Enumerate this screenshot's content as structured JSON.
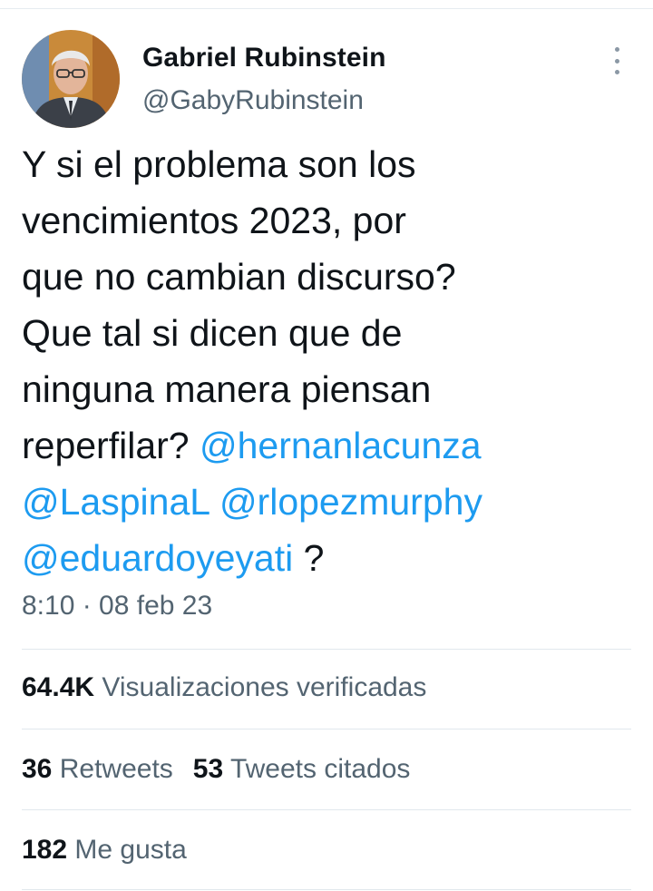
{
  "author": {
    "display_name": "Gabriel Rubinstein",
    "handle": "@GabyRubinstein"
  },
  "tweet": {
    "lines": [
      "Y si el problema son los",
      "vencimientos 2023, por",
      "que no cambian discurso?",
      "Que tal si dicen que de",
      "ninguna manera piensan"
    ],
    "line6_text": "reperfilar? ",
    "mentions": [
      "@hernanlacunza",
      "@LaspinaL",
      "@rlopezmurphy",
      "@eduardoyeyati"
    ],
    "end_text": " ?",
    "timestamp": "8:10 · 08 feb 23"
  },
  "stats": {
    "views_count": "64.4K",
    "views_label": "Visualizaciones verificadas",
    "retweets_count": "36",
    "retweets_label": "Retweets",
    "quotes_count": "53",
    "quotes_label": "Tweets citados",
    "likes_count": "182",
    "likes_label": "Me gusta"
  },
  "colors": {
    "mention": "#1d9bf0",
    "secondary_text": "#536471",
    "primary_text": "#0f1419"
  },
  "icons": {
    "more": "more-vertical-icon"
  }
}
